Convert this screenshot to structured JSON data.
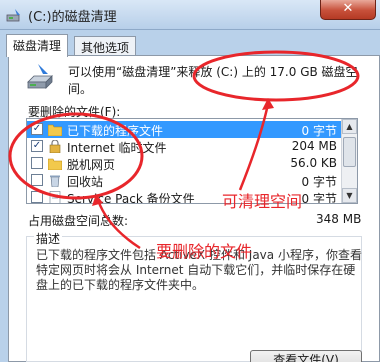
{
  "window": {
    "title": "(C:)的磁盘清理",
    "close_glyph": "✕"
  },
  "tabs": [
    {
      "label": "磁盘清理"
    },
    {
      "label": "其他选项"
    }
  ],
  "intro": {
    "text": "可以使用“磁盘清理”来释放 (C:) 上的 17.0 GB 磁盘空间。"
  },
  "files_section": {
    "label": "要删除的文件(F):",
    "items": [
      {
        "name": "已下载的程序文件",
        "size": "0 字节",
        "checked": true,
        "selected": true
      },
      {
        "name": "Internet 临时文件",
        "size": "204 MB",
        "checked": true,
        "selected": false
      },
      {
        "name": "脱机网页",
        "size": "56.0 KB",
        "checked": false,
        "selected": false
      },
      {
        "name": "回收站",
        "size": "0 字节",
        "checked": false,
        "selected": false
      },
      {
        "name": "Service Pack 备份文件",
        "size": "0 字节",
        "checked": false,
        "selected": false
      }
    ]
  },
  "space_summary": {
    "label": "占用磁盘空间总数:",
    "value": "348 MB"
  },
  "description": {
    "title": "描述",
    "text": "已下载的程序文件包括 ActiveX 控件和 Java 小程序，你查看特定网页时将会从 Internet 自动下载它们，并临时保存在硬盘上的已下载的程序文件夹中。"
  },
  "view_files_button": {
    "label": "查看文件(V)"
  },
  "annotations": [
    {
      "text": "可清理空间",
      "color": "#e8262b"
    },
    {
      "text": "要删除的文件",
      "color": "#e8262b"
    }
  ],
  "colors": {
    "annotation": "#e8262b",
    "selection": "#3399ff"
  }
}
